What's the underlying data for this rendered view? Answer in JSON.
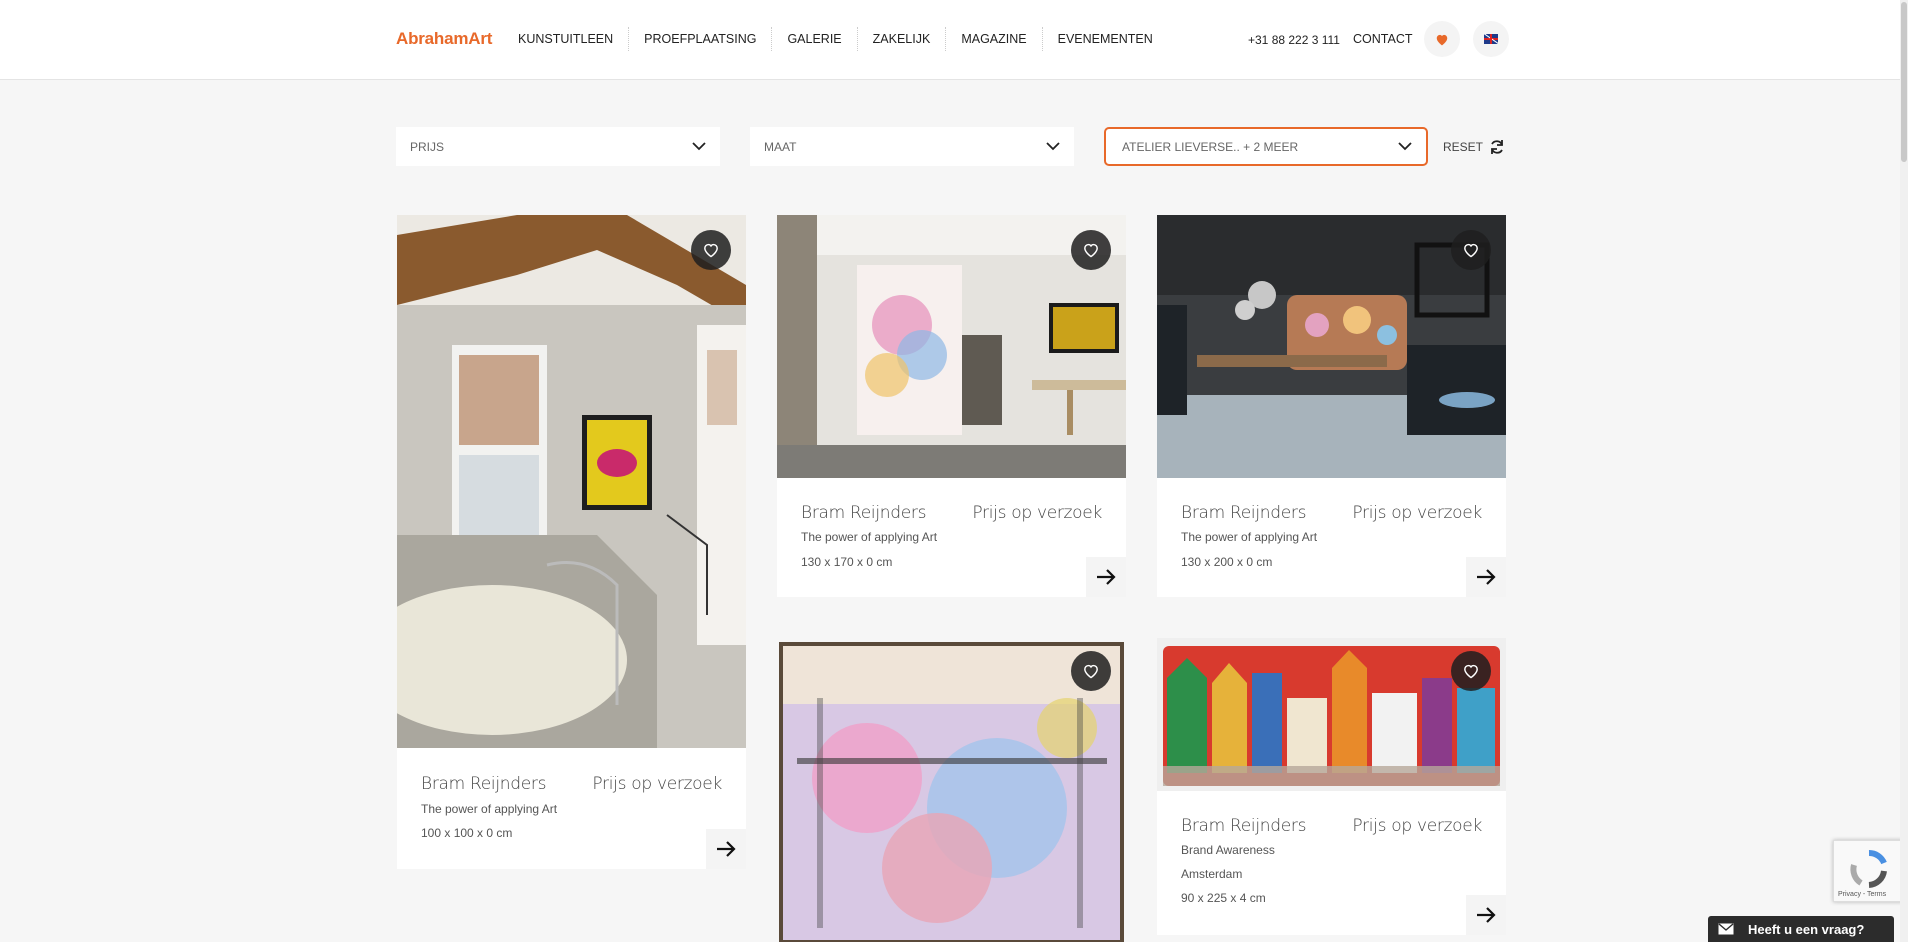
{
  "header": {
    "logo": "AbrahamArt",
    "nav": [
      "KUNSTUITLEEN",
      "PROEFPLAATSING",
      "GALERIE",
      "ZAKELIJK",
      "MAGAZINE",
      "EVENEMENTEN"
    ],
    "phone": "+31 88 222 3 111",
    "contact": "CONTACT",
    "favorites_icon": "heart-icon",
    "language_icon": "uk-flag-icon"
  },
  "filters": {
    "prijs": "PRIJS",
    "maat": "MAAT",
    "atelier": "ATELIER LIEVERSE.. + 2 MEER",
    "reset": "RESET"
  },
  "cards": [
    {
      "artist": "Bram Reijnders",
      "price": "Prijs op verzoek",
      "title": "The power of applying Art",
      "size": "100 x 100 x 0 cm"
    },
    {
      "artist": "Bram Reijnders",
      "price": "Prijs op verzoek",
      "title": "The power of applying Art",
      "size": "130 x 170 x 0 cm"
    },
    {
      "artist": "Bram Reijnders",
      "price": "Prijs op verzoek",
      "title": "The power of applying Art",
      "size": "130 x 200 x 0 cm"
    },
    {
      "artist": "Bram Reijnders",
      "price": "Prijs op verzoek",
      "title": "Brand Awareness",
      "subtitle": "Amsterdam",
      "size": "90 x 225 x 4 cm"
    }
  ],
  "widgets": {
    "recaptcha": "Privacy - Terms",
    "chat": "Heeft u een vraag?"
  },
  "colors": {
    "accent": "#e8692a",
    "background": "#f6f6f6"
  }
}
